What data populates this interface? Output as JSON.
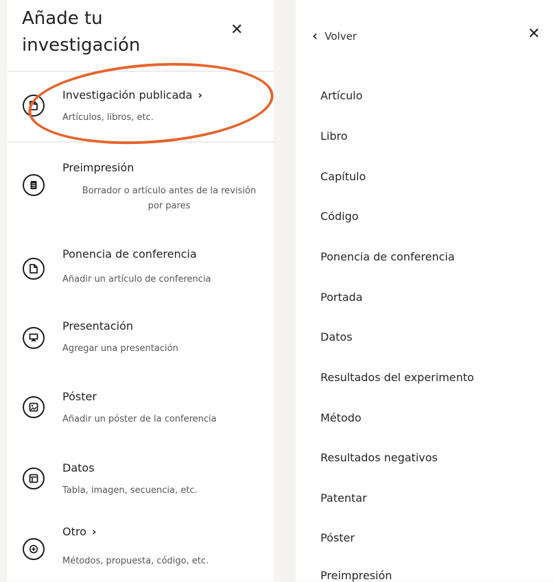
{
  "left_panel": {
    "title_line1": "Añade tu",
    "title_line2": "investigación",
    "close": "✕",
    "items": [
      {
        "title": "Investigación publicada",
        "chevron": "›",
        "subtitle": "Artículos, libros, etc.",
        "icon": "document-icon"
      },
      {
        "title": "Preimpresión",
        "subtitle": "Borrador o artículo antes de la revisión por pares",
        "icon": "clipboard-icon"
      },
      {
        "title": "Ponencia de conferencia",
        "subtitle": "Añadir un artículo de conferencia",
        "icon": "document-icon"
      },
      {
        "title": "Presentación",
        "subtitle": "Agregar una presentación",
        "icon": "presentation-board-icon"
      },
      {
        "title": "Póster",
        "subtitle": "Añadir un póster de la conferencia",
        "icon": "image-icon"
      },
      {
        "title": "Datos",
        "subtitle": "Tabla, imagen, secuencia, etc.",
        "icon": "table-layout-icon"
      },
      {
        "title": "Otro",
        "chevron": "›",
        "subtitle": "Métodos, propuesta, código, etc.",
        "icon": "plus-circle-icon"
      }
    ]
  },
  "right_panel": {
    "back_label": "Volver",
    "back_chevron": "‹",
    "close": "✕",
    "items": [
      "Artículo",
      "Libro",
      "Capítulo",
      "Código",
      "Ponencia de conferencia",
      "Portada",
      "Datos",
      "Resultados del experimento",
      "Método",
      "Resultados negativos",
      "Patentar",
      "Póster",
      "Preimpresión"
    ]
  },
  "colors": {
    "highlight": "#e5642d",
    "page_bg": "#f5f4f1",
    "panel_bg": "#ffffff"
  }
}
